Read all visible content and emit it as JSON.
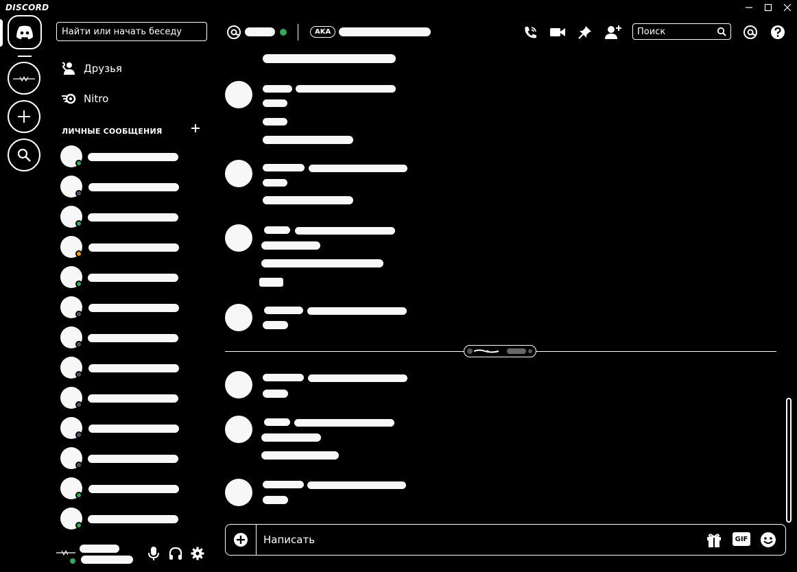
{
  "app": {
    "title": "DISCORD"
  },
  "colors": {
    "background": "#000000",
    "foreground": "#ffffff",
    "online": "#3ba55c",
    "idle": "#f0a020",
    "offline": "#2f3136"
  },
  "sidebar": {
    "search_placeholder": "Найти или начать беседу",
    "nav": [
      {
        "label": "Друзья",
        "icon": "friends-icon"
      },
      {
        "label": "Nitro",
        "icon": "nitro-icon"
      }
    ],
    "dm_header": "ЛИЧНЫЕ СООБЩЕНИЯ",
    "dm_statuses": [
      "online",
      "offline",
      "online",
      "idle",
      "online",
      "offline",
      "offline",
      "offline",
      "offline",
      "offline",
      "offline",
      "online",
      "online"
    ]
  },
  "header": {
    "aka_label": "AKA",
    "status": "online",
    "search_placeholder": "Поиск"
  },
  "composer": {
    "placeholder": "Написать",
    "gif_label": "GIF"
  }
}
